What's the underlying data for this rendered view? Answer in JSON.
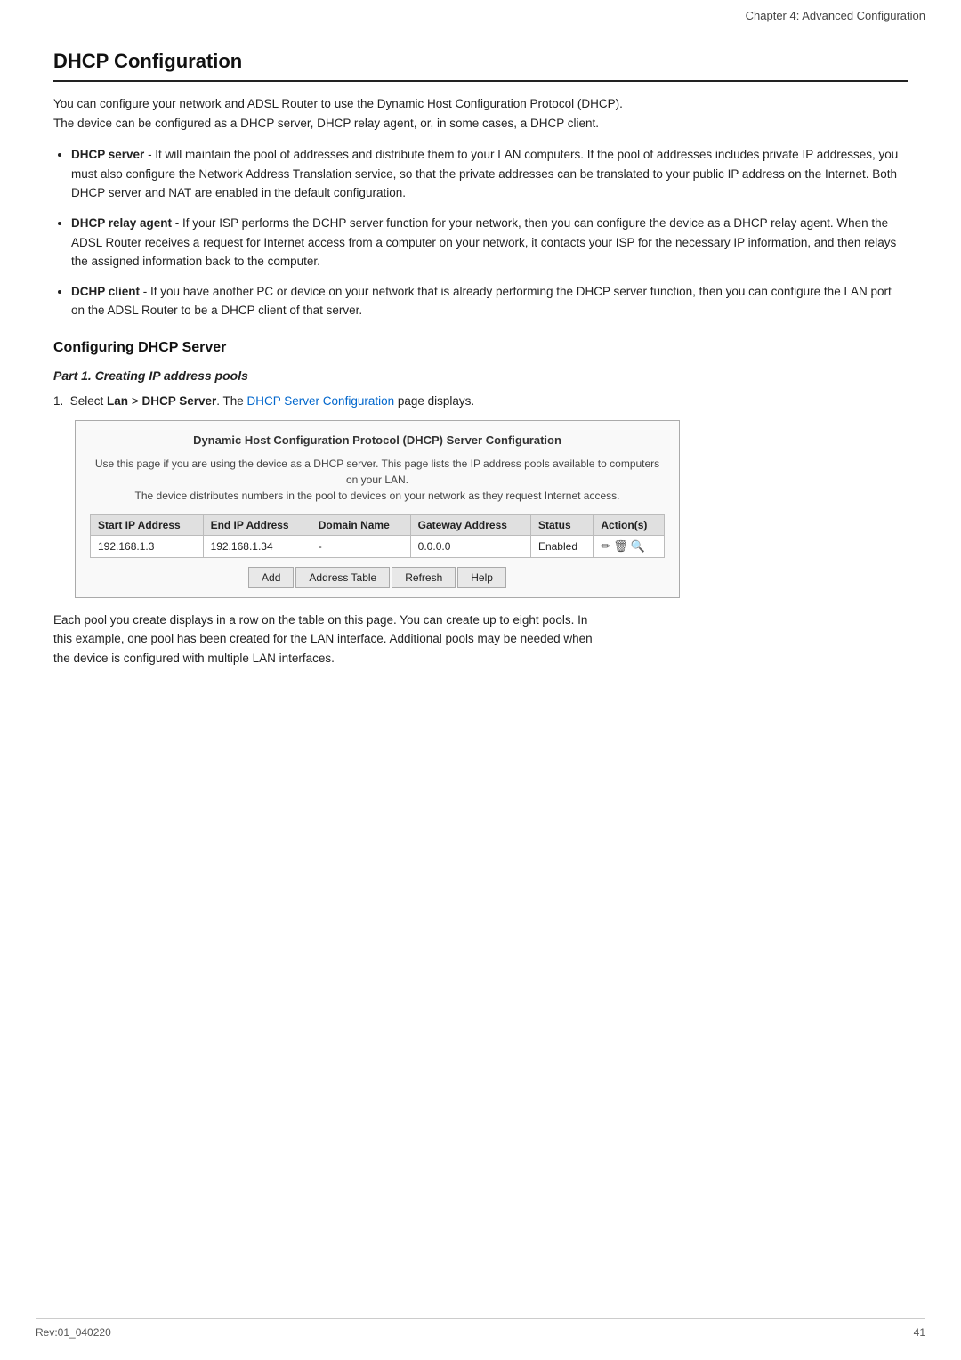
{
  "header": {
    "chapter": "Chapter 4: Advanced Configuration"
  },
  "page_title": "DHCP Configuration",
  "intro": {
    "line1": "You can configure your network and ADSL Router to use the Dynamic Host Configuration Protocol (DHCP).",
    "line2": "The device can be configured as a DHCP server, DHCP relay agent, or, in some cases, a DHCP client."
  },
  "bullets": [
    {
      "term": "DHCP server",
      "text": " - It will maintain the pool of addresses and distribute them to your LAN computers. If the pool of addresses includes private IP addresses, you must also configure the Network Address Translation service, so that the private addresses can be translated to your public IP address on the Internet. Both DHCP server and NAT are enabled in the default configuration."
    },
    {
      "term": "DHCP relay agent",
      "text": " - If your ISP performs the DCHP server function for your network, then you can configure the device as a DHCP relay agent. When the ADSL Router receives a request for Internet access from a computer on your network, it contacts your ISP for the necessary IP information, and then relays the assigned information back to the computer."
    },
    {
      "term": "DCHP client",
      "text": " - If you have another PC or device on your network that is already performing the DHCP server function, then you can configure the LAN port on the ADSL Router to be a DHCP client of that server."
    }
  ],
  "section_heading": "Configuring DHCP Server",
  "part_heading": "Part 1. Creating IP address pools",
  "step1": {
    "pre": "Select ",
    "bold1": "Lan",
    "arrow": " > ",
    "bold2": "DHCP Server",
    "post": ". The ",
    "link": "DHCP Server Configuration",
    "post2": " page displays."
  },
  "dhcp_box": {
    "title": "Dynamic Host Configuration Protocol (DHCP) Server Configuration",
    "desc_line1": "Use this page if you are using the device as a DHCP server. This page lists the IP address pools available to computers on your LAN.",
    "desc_line2": "The device distributes numbers in the pool to devices on your network as they request Internet access.",
    "table": {
      "headers": [
        "Start IP Address",
        "End IP Address",
        "Domain Name",
        "Gateway Address",
        "Status",
        "Action(s)"
      ],
      "rows": [
        {
          "start_ip": "192.168.1.3",
          "end_ip": "192.168.1.34",
          "domain_name": "-",
          "gateway": "0.0.0.0",
          "status": "Enabled",
          "actions": "✏ 🗑 🔍"
        }
      ]
    },
    "buttons": [
      "Add",
      "Address Table",
      "Refresh",
      "Help"
    ]
  },
  "after_box": {
    "line1": "Each pool you create displays in a row on the table on this page. You can create up to eight pools. In",
    "line2": "this example, one pool has been created for the LAN interface. Additional pools may be needed when",
    "line3": "the device is configured with multiple LAN interfaces."
  },
  "footer": {
    "left": "Rev:01_040220",
    "right": "41"
  }
}
